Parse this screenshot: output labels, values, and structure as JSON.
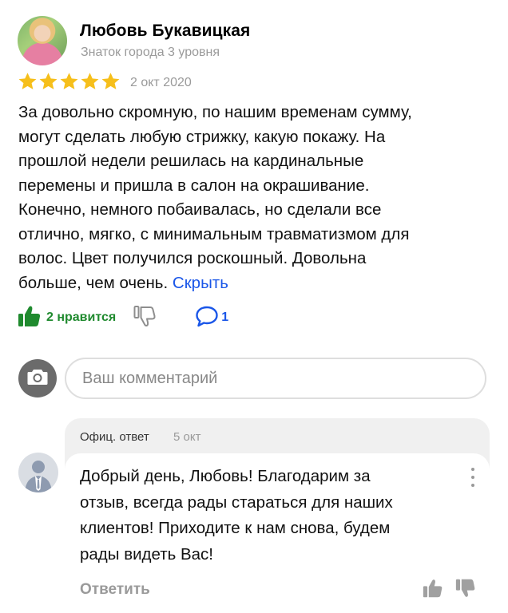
{
  "review": {
    "author_name": "Любовь Букавицкая",
    "author_level": "Знаток города 3 уровня",
    "rating": 5,
    "rating_max": 5,
    "date": "2 окт 2020",
    "text_lines": [
      "За довольно скромную, по нашим временам сумму,",
      "могут сделать любую стрижку, какую покажу. На",
      "прошлой недели решилась на кардинальные",
      "перемены и пришла в салон на окрашивание.",
      "Конечно, немного побаивалась, но сделали все",
      "отлично, мягко, с минимальным травматизмом для",
      "волос. Цвет получился роскошный. Довольна",
      "больше, чем очень."
    ],
    "hide_link": "Скрыть",
    "likes_label": "2 нравится",
    "comments_count": "1"
  },
  "comment_form": {
    "placeholder": "Ваш комментарий",
    "value": ""
  },
  "owner_reply": {
    "label": "Офиц. ответ",
    "date": "5 окт",
    "text_lines": [
      "Добрый день, Любовь! Благодарим за",
      "отзыв, всегда рады стараться для наших",
      "клиентов! Приходите к нам снова, будем",
      "рады видеть Вас!"
    ],
    "reply_action": "Ответить"
  },
  "colors": {
    "star": "#f6bf1b",
    "like": "#1f8a2e",
    "link": "#1a56e8",
    "muted": "#9a9a9a"
  }
}
